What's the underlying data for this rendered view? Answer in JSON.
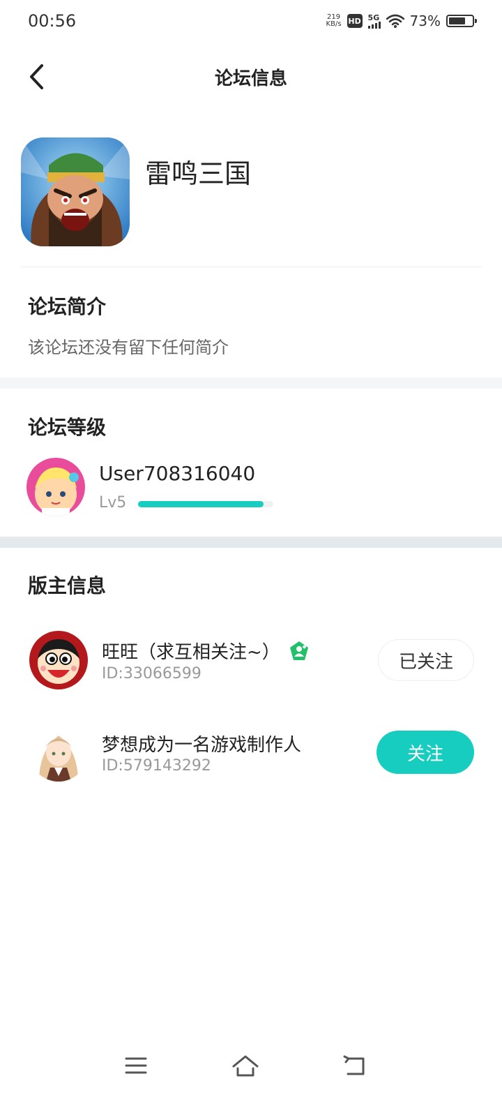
{
  "status_bar": {
    "time": "00:56",
    "speed_value": "219",
    "speed_unit": "KB/s",
    "hd": "HD",
    "network": "5G",
    "battery": "73%",
    "battery_level": 0.73
  },
  "header": {
    "title": "论坛信息",
    "back_icon": "back-chevron-icon"
  },
  "game": {
    "name": "雷鸣三国"
  },
  "intro": {
    "title": "论坛简介",
    "text": "该论坛还没有留下任何简介"
  },
  "level": {
    "title": "论坛等级",
    "username": "User708316040",
    "level_label": "Lv5",
    "progress": 0.93
  },
  "moderators": {
    "title": "版主信息",
    "items": [
      {
        "name": "旺旺（求互相关注~）",
        "id": "ID:33066599",
        "badge_icon": "moderator-badge-icon",
        "button_label": "已关注",
        "followed": true
      },
      {
        "name": "梦想成为一名游戏制作人",
        "id": "ID:579143292",
        "button_label": "关注",
        "followed": false
      }
    ]
  },
  "colors": {
    "accent": "#16cdbf",
    "badge_green": "#22c06a",
    "band_gray": "#f4f5f7",
    "band_blue_gray": "#e4e9ee"
  },
  "nav": {
    "menu_icon": "menu-icon",
    "home_icon": "home-icon",
    "back_icon": "return-icon"
  }
}
